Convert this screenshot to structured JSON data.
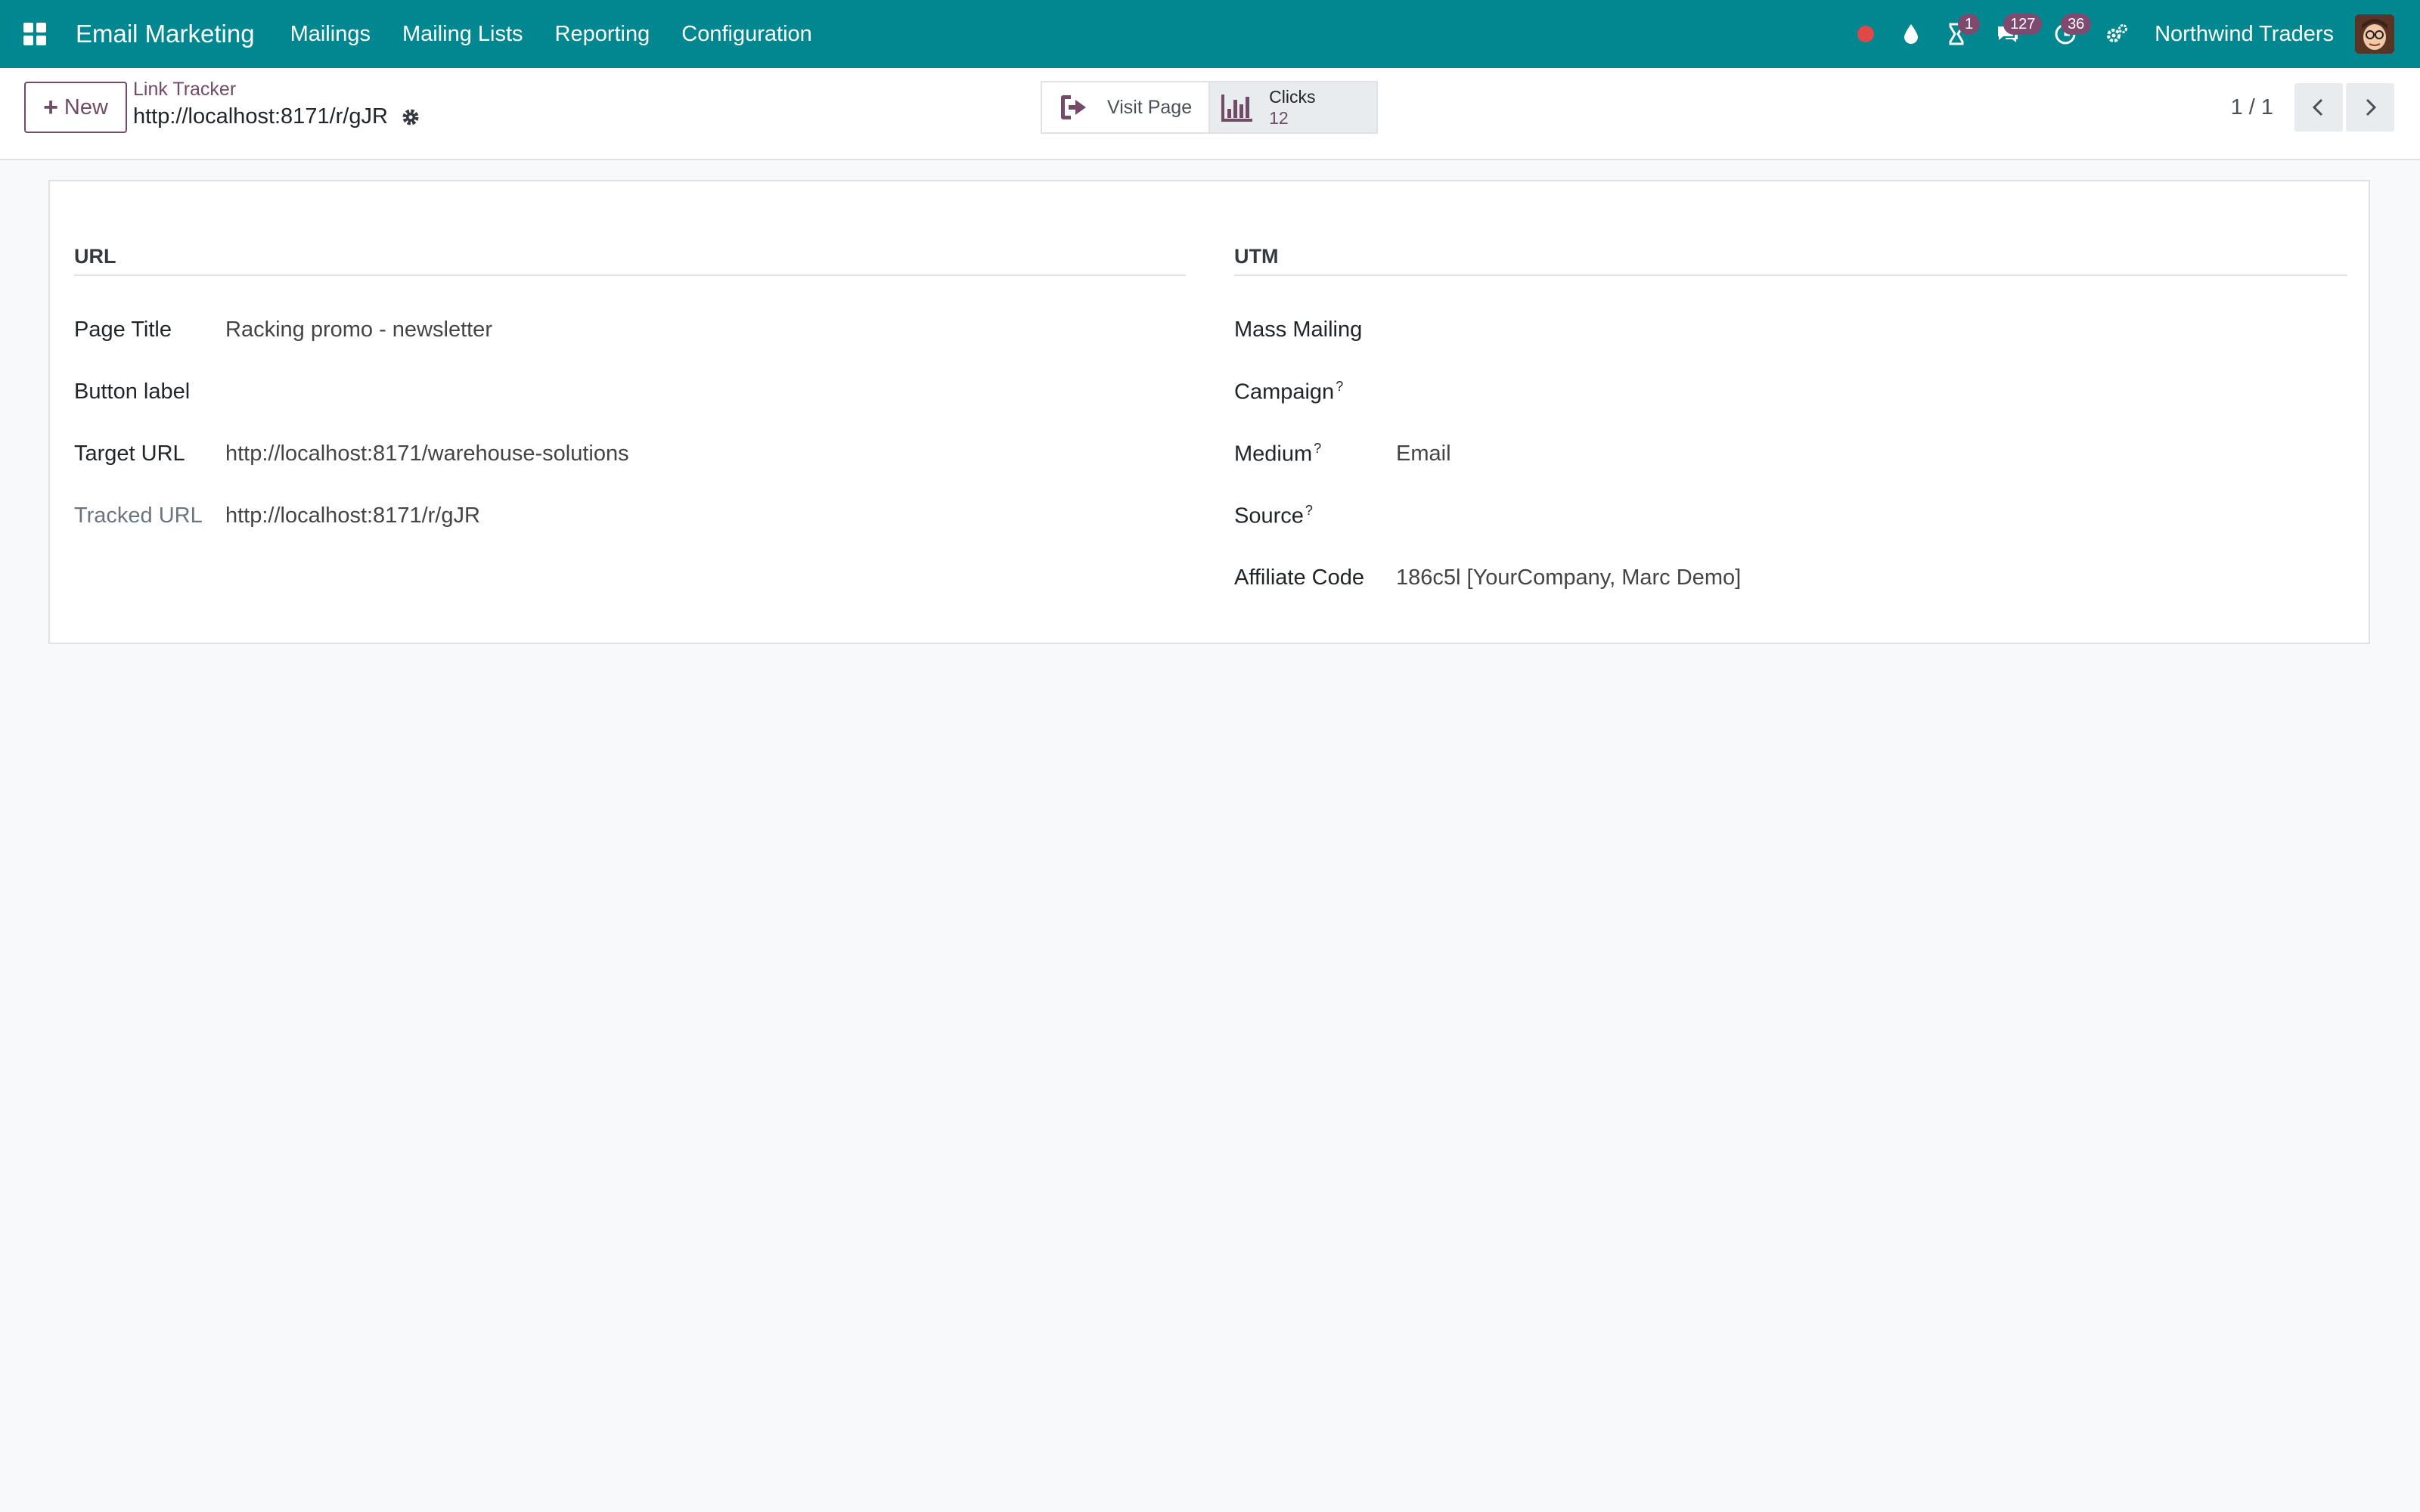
{
  "navbar": {
    "app_name": "Email Marketing",
    "menu": [
      "Mailings",
      "Mailing Lists",
      "Reporting",
      "Configuration"
    ],
    "badges": {
      "activity": "1",
      "messages": "127",
      "timers": "36"
    },
    "company": "Northwind Traders",
    "bg_color": "#00878f",
    "record_dot_color": "#e04848"
  },
  "control": {
    "new_label": "New",
    "breadcrumb": "Link Tracker",
    "record_title": "http://localhost:8171/r/gJR",
    "visit_label": "Visit Page",
    "clicks_label": "Clicks",
    "clicks_value": "12",
    "pager": "1 / 1"
  },
  "form": {
    "url_group": {
      "title": "URL",
      "page_title_label": "Page Title",
      "page_title_value": "Racking promo - newsletter",
      "button_label_label": "Button label",
      "button_label_value": "",
      "target_url_label": "Target URL",
      "target_url_value": "http://localhost:8171/warehouse-solutions",
      "tracked_url_label": "Tracked URL",
      "tracked_url_value": "http://localhost:8171/r/gJR"
    },
    "utm_group": {
      "title": "UTM",
      "mass_mailing_label": "Mass Mailing",
      "mass_mailing_value": "",
      "campaign_label": "Campaign",
      "campaign_value": "",
      "medium_label": "Medium",
      "medium_value": "Email",
      "source_label": "Source",
      "source_value": "",
      "affiliate_label": "Affiliate Code",
      "affiliate_value": "186c5l [YourCompany, Marc Demo]",
      "help_mark": "?"
    }
  },
  "accent_color": "#714b67"
}
